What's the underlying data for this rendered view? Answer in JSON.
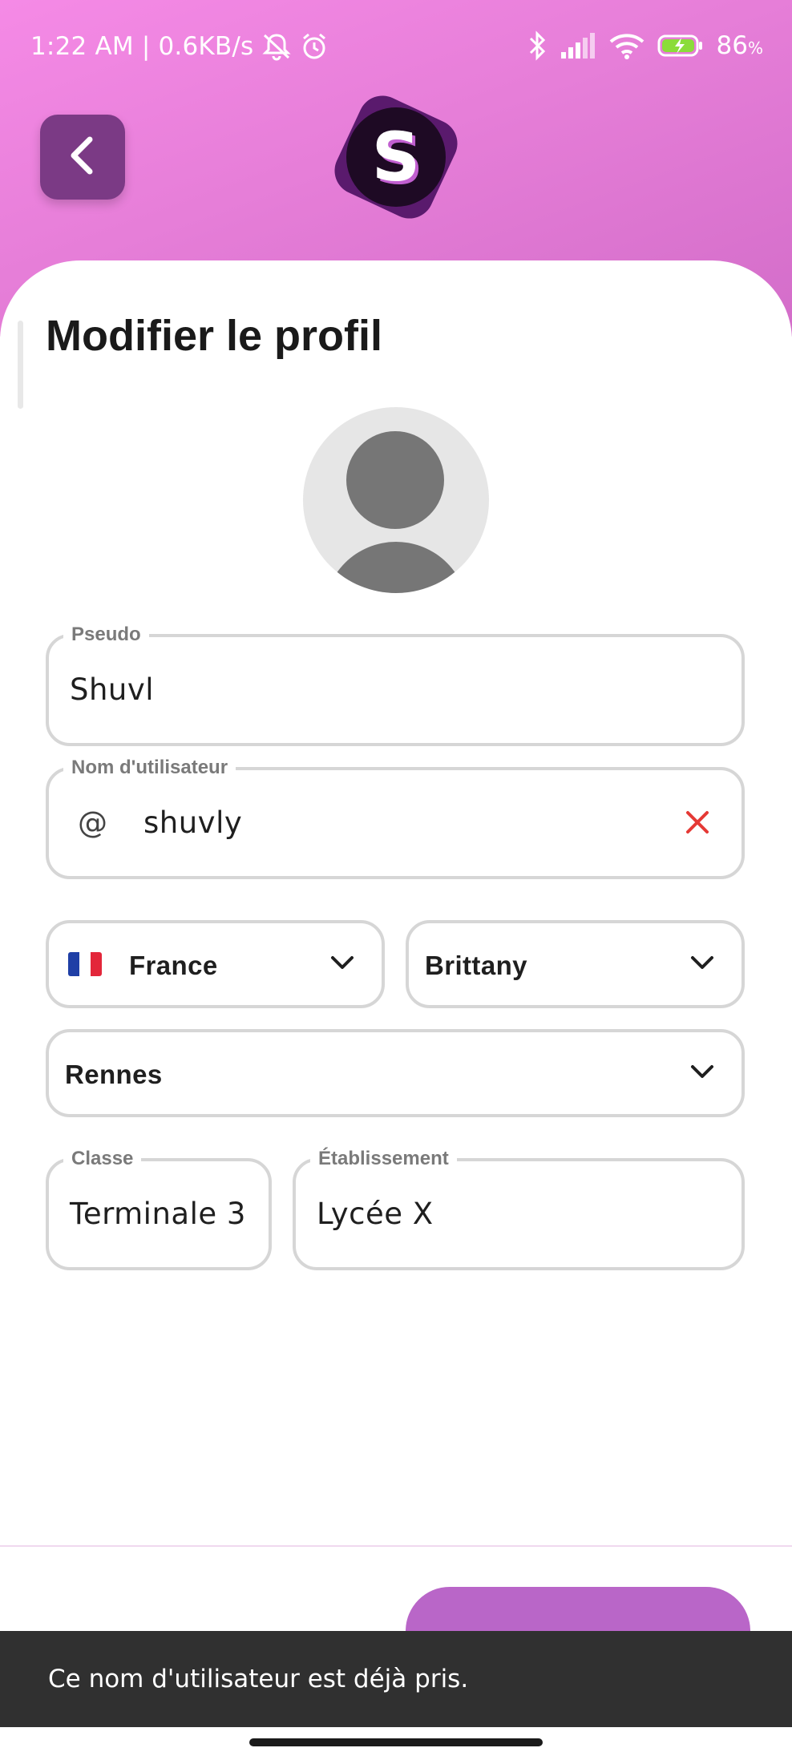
{
  "status_bar": {
    "time": "1:22 AM",
    "separator": "|",
    "network_speed": "0.6KB/s",
    "battery": "86",
    "battery_unit": "%",
    "icons": [
      "bell-off-icon",
      "alarm-icon",
      "bluetooth-icon",
      "signal-icon",
      "wifi-icon",
      "battery-charging-icon"
    ]
  },
  "header": {
    "back_icon": "chevron-left-icon",
    "logo_letter": "S"
  },
  "page": {
    "title": "Modifier le profil"
  },
  "form": {
    "pseudo": {
      "label": "Pseudo",
      "value": "Shuvl"
    },
    "username": {
      "label": "Nom d'utilisateur",
      "prefix": "@",
      "value": "shuvly",
      "clear_icon": "close-icon"
    },
    "country": {
      "value": "France",
      "flag": "france-flag-icon"
    },
    "region": {
      "value": "Brittany"
    },
    "city": {
      "value": "Rennes"
    },
    "classe": {
      "label": "Classe",
      "value": "Terminale 3"
    },
    "etablissement": {
      "label": "Établissement",
      "value": "Lycée X"
    }
  },
  "toast": {
    "message": "Ce nom d'utilisateur est déjà pris."
  },
  "colors": {
    "header_gradient_start": "#f58ae6",
    "header_gradient_end": "#d36dc9",
    "back_button": "#7b3a85",
    "accent_button": "#b966c8",
    "error": "#e53935",
    "toast_bg": "#303030"
  }
}
